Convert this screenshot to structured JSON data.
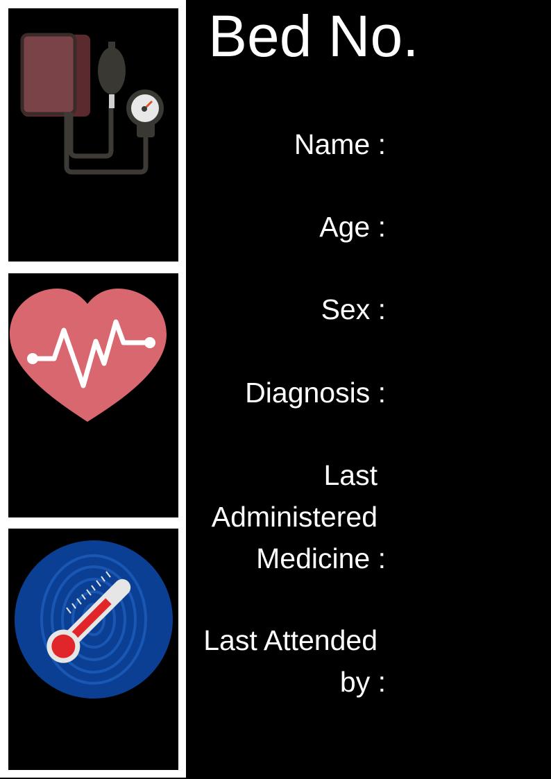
{
  "title": "Bed No.",
  "fields": {
    "name": {
      "label": "Name :"
    },
    "age": {
      "label": "Age :"
    },
    "sex": {
      "label": "Sex :"
    },
    "diagnosis": {
      "label": "Diagnosis :"
    },
    "last_medicine": {
      "lines": [
        "Last",
        "Administered",
        "Medicine :"
      ]
    },
    "last_attended": {
      "lines": [
        "Last Attended",
        "by :"
      ]
    }
  },
  "icons": [
    "blood-pressure-monitor-icon",
    "heart-pulse-icon",
    "thermometer-icon"
  ],
  "colors": {
    "background": "#000000",
    "frame": "#ffffff",
    "heart": "#d9676f",
    "cuff": "#6e3a3e",
    "thermo_bg": "#0a3f94",
    "thermo_red": "#e0262a"
  }
}
